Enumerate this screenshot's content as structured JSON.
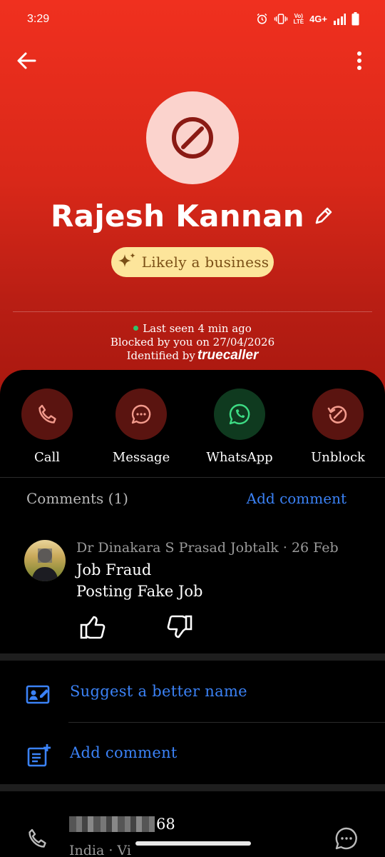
{
  "status_bar": {
    "time": "3:29",
    "network": "4G+"
  },
  "header": {
    "contact_name": "Rajesh Kannan",
    "badge_label": "Likely a business",
    "last_seen": "Last seen 4 min ago",
    "blocked_text": "Blocked by you on 27/04/2026",
    "identified_by": "Identified by",
    "identified_brand": "truecaller",
    "colors": {
      "header_red": "#e12a1b",
      "avatar_bg": "#fbd3cd",
      "badge_bg": "#fde59b",
      "online_green": "#2fc46a"
    },
    "icons": {
      "back": "arrow-left-icon",
      "more": "more-vertical-icon",
      "avatar": "block-icon",
      "edit": "pencil-icon",
      "badge": "sparkle-icon"
    }
  },
  "actions": [
    {
      "label": "Call",
      "icon": "phone-icon"
    },
    {
      "label": "Message",
      "icon": "chat-bubble-icon"
    },
    {
      "label": "WhatsApp",
      "icon": "whatsapp-icon"
    },
    {
      "label": "Unblock",
      "icon": "unblock-icon"
    }
  ],
  "comments": {
    "title": "Comments (1)",
    "add_link": "Add comment",
    "items": [
      {
        "author": "Dr Dinakara S Prasad Jobtalk · 26 Feb",
        "lines": [
          "Job Fraud",
          "Posting Fake Job"
        ]
      }
    ]
  },
  "menu": {
    "suggest_name": "Suggest a better name",
    "add_comment": "Add comment"
  },
  "phone": {
    "number_suffix": "68",
    "region": "India · Vi"
  },
  "accent_color": "#3b82f6"
}
